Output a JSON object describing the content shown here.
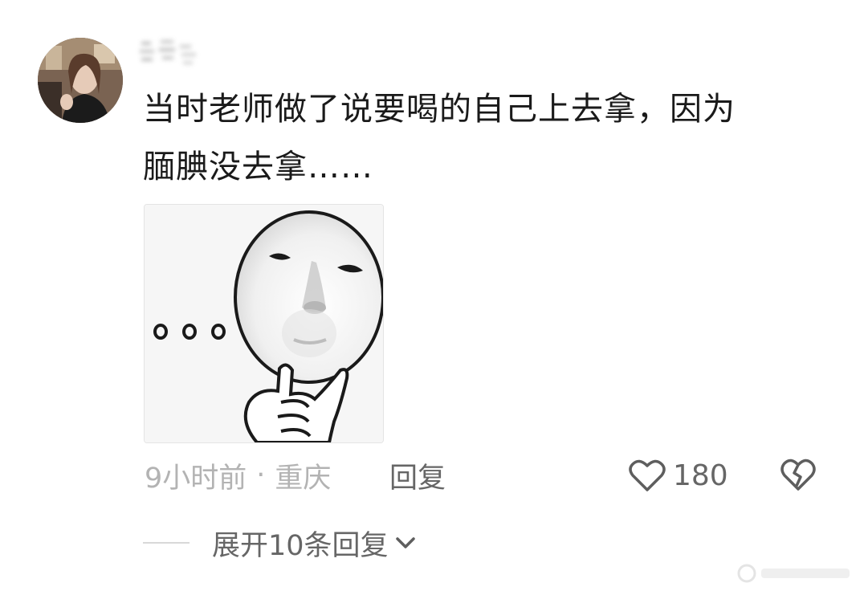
{
  "comment": {
    "line1": "当时老师做了说要喝的自己上去拿，因为",
    "line2": "腼腆没去拿……"
  },
  "meta": {
    "time": "9小时前",
    "separator": "·",
    "location": "重庆",
    "reply_label": "回复",
    "like_count": "180"
  },
  "expand": {
    "label": "展开10条回复"
  },
  "icons": {
    "avatar": "user-avatar",
    "sticker": "thinking-face-sticker",
    "like": "heart-outline-icon",
    "dislike": "broken-heart-icon",
    "expand": "chevron-down-icon"
  },
  "colors": {
    "text_primary": "#1a1a1a",
    "text_secondary": "#666666",
    "text_muted": "#b3b3b3"
  }
}
